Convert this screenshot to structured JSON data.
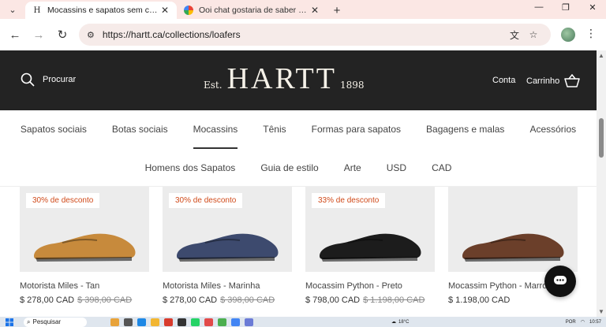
{
  "browser": {
    "tabs": [
      {
        "title": "Mocassins e sapatos sem cadarço",
        "favicon": "H",
        "active": true
      },
      {
        "title": "Ooi chat gostaria de saber de qual",
        "favicon": "google-icon",
        "active": false
      }
    ],
    "url": "https://hartt.ca/collections/loafers"
  },
  "header": {
    "search_label": "Procurar",
    "logo_est": "Est.",
    "logo_brand": "HARTT",
    "logo_year": "1898",
    "account_label": "Conta",
    "cart_label": "Carrinho"
  },
  "nav_primary": [
    {
      "label": "Sapatos sociais",
      "active": false
    },
    {
      "label": "Botas sociais",
      "active": false
    },
    {
      "label": "Mocassins",
      "active": true
    },
    {
      "label": "Tênis",
      "active": false
    },
    {
      "label": "Formas para sapatos",
      "active": false
    },
    {
      "label": "Bagagens e malas",
      "active": false
    },
    {
      "label": "Acessórios",
      "active": false
    }
  ],
  "nav_secondary": [
    {
      "label": "Homens dos Sapatos"
    },
    {
      "label": "Guia de estilo"
    },
    {
      "label": "Arte"
    },
    {
      "label": "USD"
    },
    {
      "label": "CAD"
    }
  ],
  "products": [
    {
      "badge": "30% de desconto",
      "name": "Motorista Miles - Tan",
      "price": "$ 278,00 CAD",
      "old_price": "$ 398,00 CAD",
      "color": "#c78a3c"
    },
    {
      "badge": "30% de desconto",
      "name": "Motorista Miles - Marinha",
      "price": "$ 278,00 CAD",
      "old_price": "$ 398,00 CAD",
      "color": "#3d4a6e"
    },
    {
      "badge": "33% de desconto",
      "name": "Mocassim Python - Preto",
      "price": "$ 798,00 CAD",
      "old_price": "$ 1.198,00 CAD",
      "color": "#1c1c1c"
    },
    {
      "badge": "",
      "name": "Mocassim Python - Marrom",
      "price": "$ 1.198,00 CAD",
      "old_price": "",
      "color": "#6b3f2a"
    }
  ],
  "taskbar": {
    "search_label": "Pesquisar",
    "temperature": "18°C",
    "lang": "POR",
    "time": "10:57"
  }
}
